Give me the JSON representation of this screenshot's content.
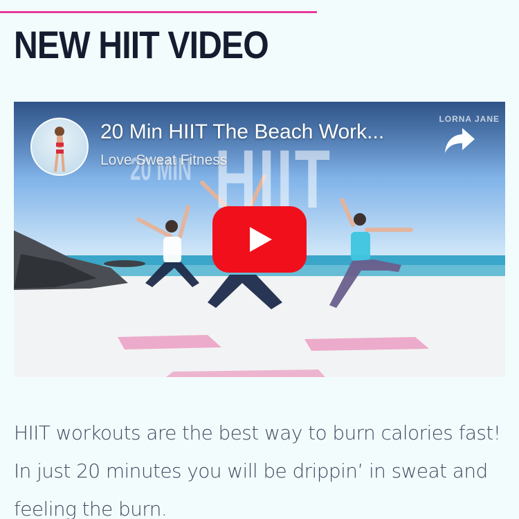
{
  "page": {
    "heading": "NEW HIIT VIDEO",
    "accent_color": "#e8399c",
    "heading_color": "#141c30"
  },
  "video": {
    "title": "20 Min HIIT The Beach Work...",
    "channel": "Love Sweat Fitness",
    "overlay_big_text": "HIIT",
    "overlay_small_text": "20 MIN",
    "brand_logo": "LORNA JANE",
    "play_icon": "youtube-play-icon",
    "share_icon": "share-arrow-icon",
    "play_color": "#f00f1b"
  },
  "article": {
    "paragraph": "HIIT workouts are the best way to burn calories fast! In just 20 minutes you will be drippin’ in sweat and feeling the burn."
  }
}
